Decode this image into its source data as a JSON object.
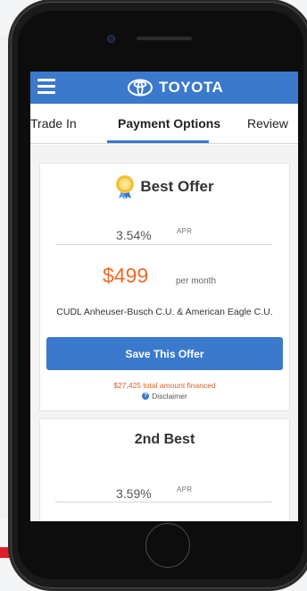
{
  "app": {
    "brand": "TOYOTA"
  },
  "tabs": [
    {
      "label": "Trade In"
    },
    {
      "label": "Payment Options"
    },
    {
      "label": "Review"
    }
  ],
  "best_offer": {
    "title": "Best Offer",
    "rate": "3.54%",
    "rate_unit": "APR",
    "price": "$499",
    "price_period": "per month",
    "lender": "CUDL Anheuser-Busch C.U. & American Eagle C.U.",
    "button_label": "Save This Offer",
    "financed": "$27,425 total amount financed",
    "disclaimer": "Disclaimer"
  },
  "second_offer": {
    "title": "2nd Best",
    "rate": "3.59%",
    "rate_unit": "APR"
  },
  "icons": {
    "menu": "hamburger-menu-icon",
    "logo": "toyota-logo-icon",
    "medal": "medal-icon",
    "help": "question-circle-icon"
  },
  "colors": {
    "primary": "#3a79cc",
    "price": "#ef6a2a",
    "financed": "#d9602b"
  }
}
